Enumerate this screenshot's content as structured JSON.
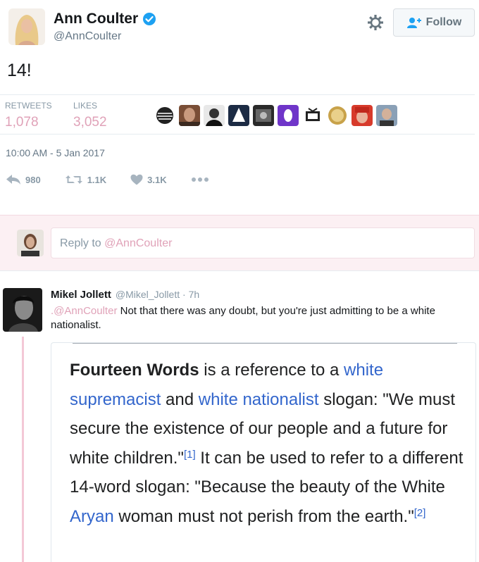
{
  "profile": {
    "name": "Ann Coulter",
    "handle": "@AnnCoulter",
    "follow_label": "Follow"
  },
  "tweet": {
    "text": "14!",
    "retweets_label": "RETWEETS",
    "retweets_value": "1,078",
    "likes_label": "LIKES",
    "likes_value": "3,052",
    "timestamp": "10:00 AM - 5 Jan 2017",
    "actions": {
      "reply_count": "980",
      "retweet_count": "1.1K",
      "like_count": "3.1K"
    }
  },
  "reply_bar": {
    "prefix": "Reply to ",
    "mention": "@AnnCoulter"
  },
  "reply_tweet": {
    "name": "Mikel Jollett",
    "handle": "@Mikel_Jollett",
    "time": "7h",
    "mention": ".@AnnCoulter",
    "text_line": " Not that there was any doubt, but you're just admitting to be a white nationalist."
  },
  "wiki": {
    "term": "Fourteen Words",
    "t1": " is a reference to a ",
    "link1": "white supremacist",
    "t2": " and ",
    "link2": "white nationalist",
    "t3": " slogan: \"We must secure the existence of our people and a future for white children.\"",
    "ref1": "[1]",
    "t4": " It can be used to refer to a different 14-word slogan: \"Because the beauty of the White ",
    "link3": "Aryan",
    "t5": " woman must not perish from the earth.\"",
    "ref2": "[2]"
  },
  "colors": {
    "accent_pink": "#e0a2b8",
    "verified_blue": "#1da1f2",
    "wiki_link": "#3366cc"
  }
}
